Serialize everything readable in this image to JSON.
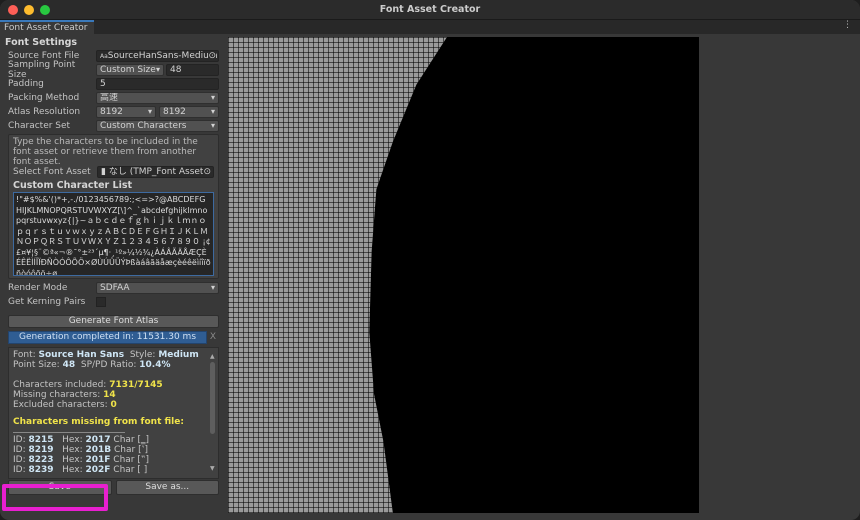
{
  "window": {
    "title": "Font Asset Creator",
    "tab": "Font Asset Creator",
    "menu_icon": "kebab-menu-icon"
  },
  "settings": {
    "heading": "Font Settings",
    "source_font_label": "Source Font File",
    "source_font_value": "SourceHanSans-Medium",
    "sampling_label": "Sampling Point Size",
    "sampling_mode": "Custom Size",
    "sampling_value": "48",
    "padding_label": "Padding",
    "padding_value": "5",
    "packing_label": "Packing Method",
    "packing_value": "高速",
    "atlas_label": "Atlas Resolution",
    "atlas_w": "8192",
    "atlas_h": "8192",
    "charset_label": "Character Set",
    "charset_value": "Custom Characters",
    "help": "Type the characters to be included in the font asset or retrieve them from another font asset.",
    "select_asset_label": "Select Font Asset",
    "select_asset_value": "なし (TMP_Font Asset)",
    "custom_list_label": "Custom Character List",
    "custom_list": "!\"#$%&'()*+,-./0123456789:;<=>?@ABCDEFGHIJKLMNOPQRSTUVWXYZ[\\]^_`abcdefghijklmnopqrstuvwxyz{|}~ａｂｃｄｅｆｇｈｉｊｋｌｍｎｏｐｑｒｓｔｕｖｗｘｙｚＡＢＣＤＥＦＧＨＩＪＫＬＭＮＯＰＱＲＳＴＵＶＷＸＹＺ１２３４５６７８９０ ¡¢£¤¥¦§¨©ª«¬®¯°±²³´µ¶·¸¹º»¼½¾¿ÀÁÂÃÄÅÆÇÈÉÊËÌÍÎÏÐÑÒÓÔÕÖ×ØÙÚÛÜÝÞßàáâãäåæçèéêëìíîïðñòóôõö÷ø",
    "render_label": "Render Mode",
    "render_value": "SDFAA",
    "kerning_label": "Get Kerning Pairs",
    "kerning_checked": false,
    "generate_label": "Generate Font Atlas",
    "progress_text": "Generation completed in: 11531.30 ms",
    "progress": 1.0,
    "progress_close": "X"
  },
  "info": {
    "font_label": "Font:",
    "font_value": "Source Han Sans",
    "style_label": "Style:",
    "style_value": "Medium",
    "size_label": "Point Size:",
    "size_value": "48",
    "ratio_label": "SP/PD Ratio:",
    "ratio_value": "10.4%",
    "included_label": "Characters included:",
    "included_value": "7131/7145",
    "missing_label": "Missing characters:",
    "missing_value": "14",
    "excluded_label": "Excluded characters:",
    "excluded_value": "0",
    "missing_heading": "Characters missing from font file:",
    "missing_rows": [
      {
        "id": "8215",
        "hex": "2017",
        "char": "[‗]"
      },
      {
        "id": "8219",
        "hex": "201B",
        "char": "[‛]"
      },
      {
        "id": "8223",
        "hex": "201F",
        "char": "[‟]"
      },
      {
        "id": "8239",
        "hex": "202F",
        "char": "[ ]"
      }
    ]
  },
  "footer": {
    "save": "Save",
    "save_as": "Save as..."
  },
  "colors": {
    "accent": "#3a79bb",
    "progress": "#2f5d93",
    "highlight": "#e81fd0",
    "value_yellow": "#f0e34a"
  }
}
